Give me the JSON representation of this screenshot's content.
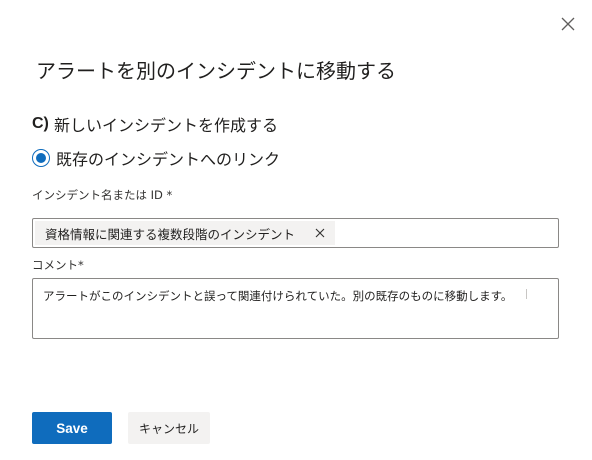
{
  "dialog": {
    "title": "アラートを別のインシデントに移動する",
    "close_icon": "close-icon"
  },
  "options": {
    "new_incident": {
      "prefix": "C)",
      "label": "新しいインシデントを作成する",
      "selected": false
    },
    "existing_incident": {
      "label": "既存のインシデントへのリンク",
      "selected": true
    }
  },
  "incident_field": {
    "label": "インシデント名または ID *",
    "selected_tag": "資格情報に関連する複数段階のインシデント",
    "remove_icon": "close-icon"
  },
  "comment_field": {
    "label": "コメント*",
    "value": "アラートがこのインシデントと誤って関連付けられていた。別の既存のものに移動します。"
  },
  "buttons": {
    "save": "Save",
    "cancel": "キャンセル"
  },
  "colors": {
    "accent": "#0f6cbd",
    "secondary_button": "#f3f2f1",
    "border": "#8a8886"
  }
}
